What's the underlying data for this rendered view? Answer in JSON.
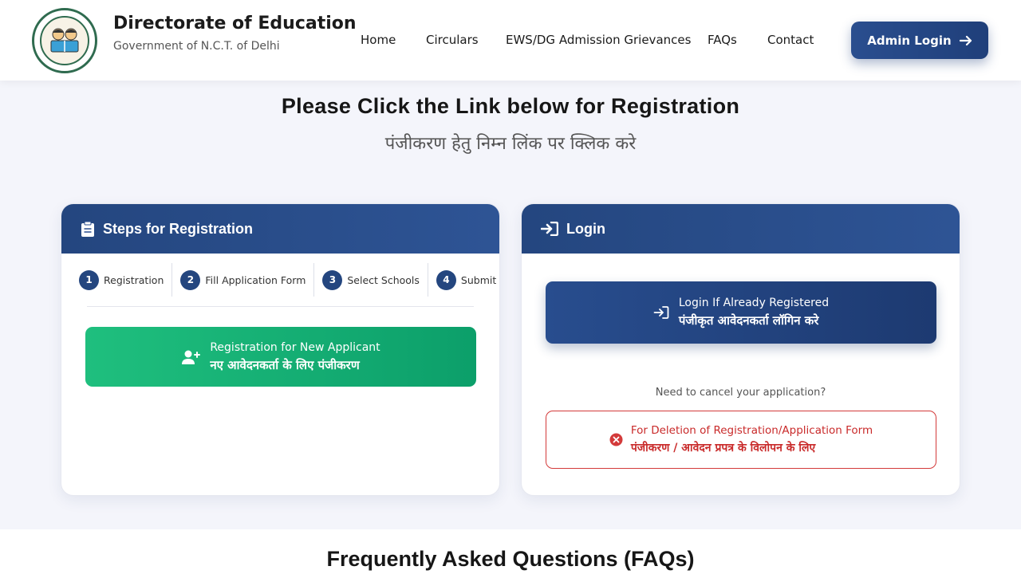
{
  "header": {
    "title": "Directorate of Education",
    "subtitle": "Government of N.C.T. of Delhi",
    "nav": [
      "Home",
      "Circulars",
      "EWS/DG Admission Grievances",
      "FAQs",
      "Contact"
    ],
    "admin_login": "Admin Login"
  },
  "hero": {
    "title": "Please Click the Link below for Registration",
    "title_hindi": "पंजीकरण हेतु निम्न लिंक पर क्लिक करे"
  },
  "steps_card": {
    "title": "Steps for Registration",
    "steps": [
      {
        "num": "1",
        "label": "Registration"
      },
      {
        "num": "2",
        "label": "Fill Application Form"
      },
      {
        "num": "3",
        "label": "Select Schools"
      },
      {
        "num": "4",
        "label": "Submit"
      }
    ],
    "register_button": {
      "line1": "Registration for New Applicant",
      "line2": "नए आवेदनकर्ता के लिए पंजीकरण"
    }
  },
  "login_card": {
    "title": "Login",
    "login_button": {
      "line1": "Login If Already Registered",
      "line2": "पंजीकृत आवेदनकर्ता लॉगिन करे"
    },
    "cancel_question": "Need to cancel your application?",
    "delete_button": {
      "line1": "For Deletion of Registration/Application Form",
      "line2": "पंजीकरण / आवेदन प्रपत्र के विलोपन के लिए"
    }
  },
  "faq": {
    "title": "Frequently Asked Questions (FAQs)"
  },
  "colors": {
    "primary": "#24467f",
    "success": "#13b274",
    "danger": "#d33a3a"
  }
}
